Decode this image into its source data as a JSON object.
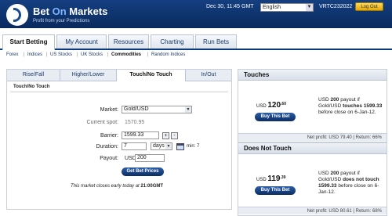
{
  "header": {
    "brand_part1": "Bet",
    "brand_part2": "On",
    "brand_part3": "Markets",
    "tagline": "Profit from your Predictions",
    "datetime": "Dec 30, 11:45 GMT",
    "language": "English",
    "account_id": "VRTC232022",
    "logout_label": "Log Out"
  },
  "main_tabs": [
    "Start Betting",
    "My Account",
    "Resources",
    "Charting",
    "Run Bets"
  ],
  "sub_nav": [
    "Forex",
    "Indices",
    "US Stocks",
    "UK Stocks",
    "Commodities",
    "Random Indices"
  ],
  "bet_tabs": [
    "Rise/Fall",
    "Higher/Lower",
    "Touch/No Touch",
    "In/Out"
  ],
  "form": {
    "section_title": "Touch/No Touch",
    "market_label": "Market:",
    "market_value": "Gold/USD",
    "current_spot_label": "Current spot:",
    "current_spot_value": "1570.95",
    "barrier_label": "Barrier:",
    "barrier_value": "1599.33",
    "plus_label": "+",
    "minus_label": "-",
    "duration_label": "Duration:",
    "duration_value": "7",
    "duration_unit": "days",
    "duration_min": "min: 7",
    "payout_label": "Payout:",
    "payout_currency": "USD",
    "payout_value": "200",
    "get_prices_label": "Get Bet Prices",
    "note_text": "This market closes early today at",
    "note_time": "21:00GMT"
  },
  "cards": [
    {
      "title": "Touches",
      "currency": "USD",
      "price_main": "120",
      "price_dec": ".60",
      "buy_label": "Buy This Bet",
      "desc_a": "USD",
      "desc_amount": "200",
      "desc_b": "payout if Gold/USD",
      "desc_verb": "touches",
      "desc_barrier": "1599.33",
      "desc_c": "before close on 6-Jan-12.",
      "footer": "Net profit: USD 79.40 | Return: 66%"
    },
    {
      "title": "Does Not Touch",
      "currency": "USD",
      "price_main": "119",
      "price_dec": ".39",
      "buy_label": "Buy This Bet",
      "desc_a": "USD",
      "desc_amount": "200",
      "desc_b": "payout if Gold/USD",
      "desc_verb": "does not touch",
      "desc_barrier": "1599.33",
      "desc_c": "before close on 6-Jan-12.",
      "footer": "Net profit: USD 80.61 | Return: 68%"
    }
  ],
  "colors": {
    "header_bg": "#0d3471",
    "accent_blue": "#0b2d63",
    "logout_yellow": "#f0b820"
  }
}
